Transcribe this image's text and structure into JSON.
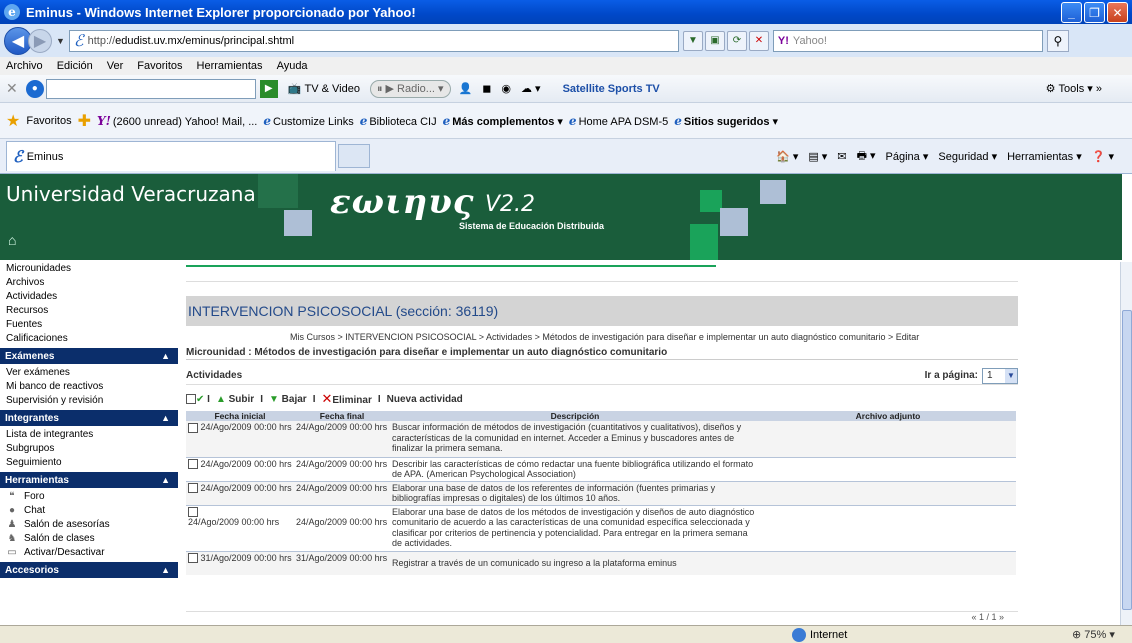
{
  "window": {
    "title": "Eminus - Windows Internet Explorer proporcionado por Yahoo!"
  },
  "address": {
    "url_host": "http://",
    "url_rest": "edudist.uv.mx/eminus/principal.shtml",
    "search_placeholder": "Yahoo!"
  },
  "menu": [
    "Archivo",
    "Edición",
    "Ver",
    "Favoritos",
    "Herramientas",
    "Ayuda"
  ],
  "toolbar2": {
    "tv": "TV & Video",
    "radio": "Radio...",
    "satellite": "Satellite Sports TV",
    "tools": "Tools"
  },
  "favorites": {
    "label": "Favoritos",
    "items": [
      "(2600 unread) Yahoo! Mail, ...",
      "Customize Links",
      "Biblioteca CIJ",
      "Más complementos",
      "Home APA DSM-5",
      "Sitios sugeridos"
    ]
  },
  "tab": {
    "label": "Eminus"
  },
  "cmdbar": {
    "pagina": "Página",
    "seguridad": "Seguridad",
    "herramientas": "Herramientas"
  },
  "banner": {
    "university": "Universidad Veracruzana",
    "logo": "εωιηυς",
    "version": "V2.2",
    "subtitle": "Sistema de Educación Distribuida"
  },
  "sidebar": {
    "top_items": [
      "Microunidades",
      "Archivos",
      "Actividades",
      "Recursos",
      "Fuentes",
      "Calificaciones"
    ],
    "sections": [
      {
        "title": "Exámenes",
        "items": [
          "Ver exámenes",
          "Mi banco de reactivos",
          "Supervisión y revisión"
        ]
      },
      {
        "title": "Integrantes",
        "items": [
          "Lista de integrantes",
          "Subgrupos",
          "Seguimiento"
        ]
      },
      {
        "title": "Herramientas",
        "items": [
          "Foro",
          "Chat",
          "Salón de asesorías",
          "Salón de clases",
          "Activar/Desactivar"
        ]
      },
      {
        "title": "Accesorios",
        "items": []
      }
    ]
  },
  "main": {
    "course_title": "INTERVENCION PSICOSOCIAL (sección: 36119)",
    "breadcrumb": "Mis Cursos > INTERVENCION PSICOSOCIAL > Actividades > Métodos de investigación para diseñar e implementar un auto diagnóstico comunitario > Editar",
    "microunit": "Microunidad : Métodos de investigación para diseñar e implementar un auto diagnóstico comunitario",
    "activities_label": "Actividades",
    "goto_page_label": "Ir a página:",
    "goto_page_value": "1",
    "tools": {
      "subir": "Subir",
      "bajar": "Bajar",
      "eliminar": "Eliminar",
      "nueva": "Nueva actividad"
    },
    "columns": [
      "Fecha inicial",
      "Fecha final",
      "Descripción",
      "Archivo adjunto"
    ],
    "rows": [
      {
        "start": "24/Ago/2009 00:00 hrs",
        "end": "24/Ago/2009 00:00 hrs",
        "desc": "Buscar información de métodos de investigación (cuantitativos y cualitativos), diseños y características de la comunidad en internet. Acceder a Eminus y buscadores antes de finalizar la primera semana.",
        "file": ""
      },
      {
        "start": "24/Ago/2009 00:00 hrs",
        "end": "24/Ago/2009 00:00 hrs",
        "desc": "Describir las características de cómo redactar una fuente bibliográfica utilizando el formato de APA. (American Psychological Association)",
        "file": ""
      },
      {
        "start": "24/Ago/2009 00:00 hrs",
        "end": "24/Ago/2009 00:00 hrs",
        "desc": "Elaborar una base de datos de los referentes de información (fuentes primarias y bibliografías impresas o digitales) de los últimos 10 años.",
        "file": ""
      },
      {
        "start": "24/Ago/2009 00:00 hrs",
        "end": "24/Ago/2009 00:00 hrs",
        "desc": "Elaborar una base de datos de los métodos de investigación y diseños de auto diagnóstico comunitario de acuerdo a las características de una comunidad específica seleccionada y clasificar por criterios de pertinencia y potencialidad. Para entregar en la primera semana de actividades.",
        "file": ""
      },
      {
        "start": "31/Ago/2009 00:00 hrs",
        "end": "31/Ago/2009 00:00 hrs",
        "desc": "Registrar a través de un comunicado su ingreso a la plataforma eminus",
        "file": ""
      }
    ],
    "pager": "« 1 / 1 »"
  },
  "status": {
    "zone": "Internet",
    "zoom": "75%"
  }
}
